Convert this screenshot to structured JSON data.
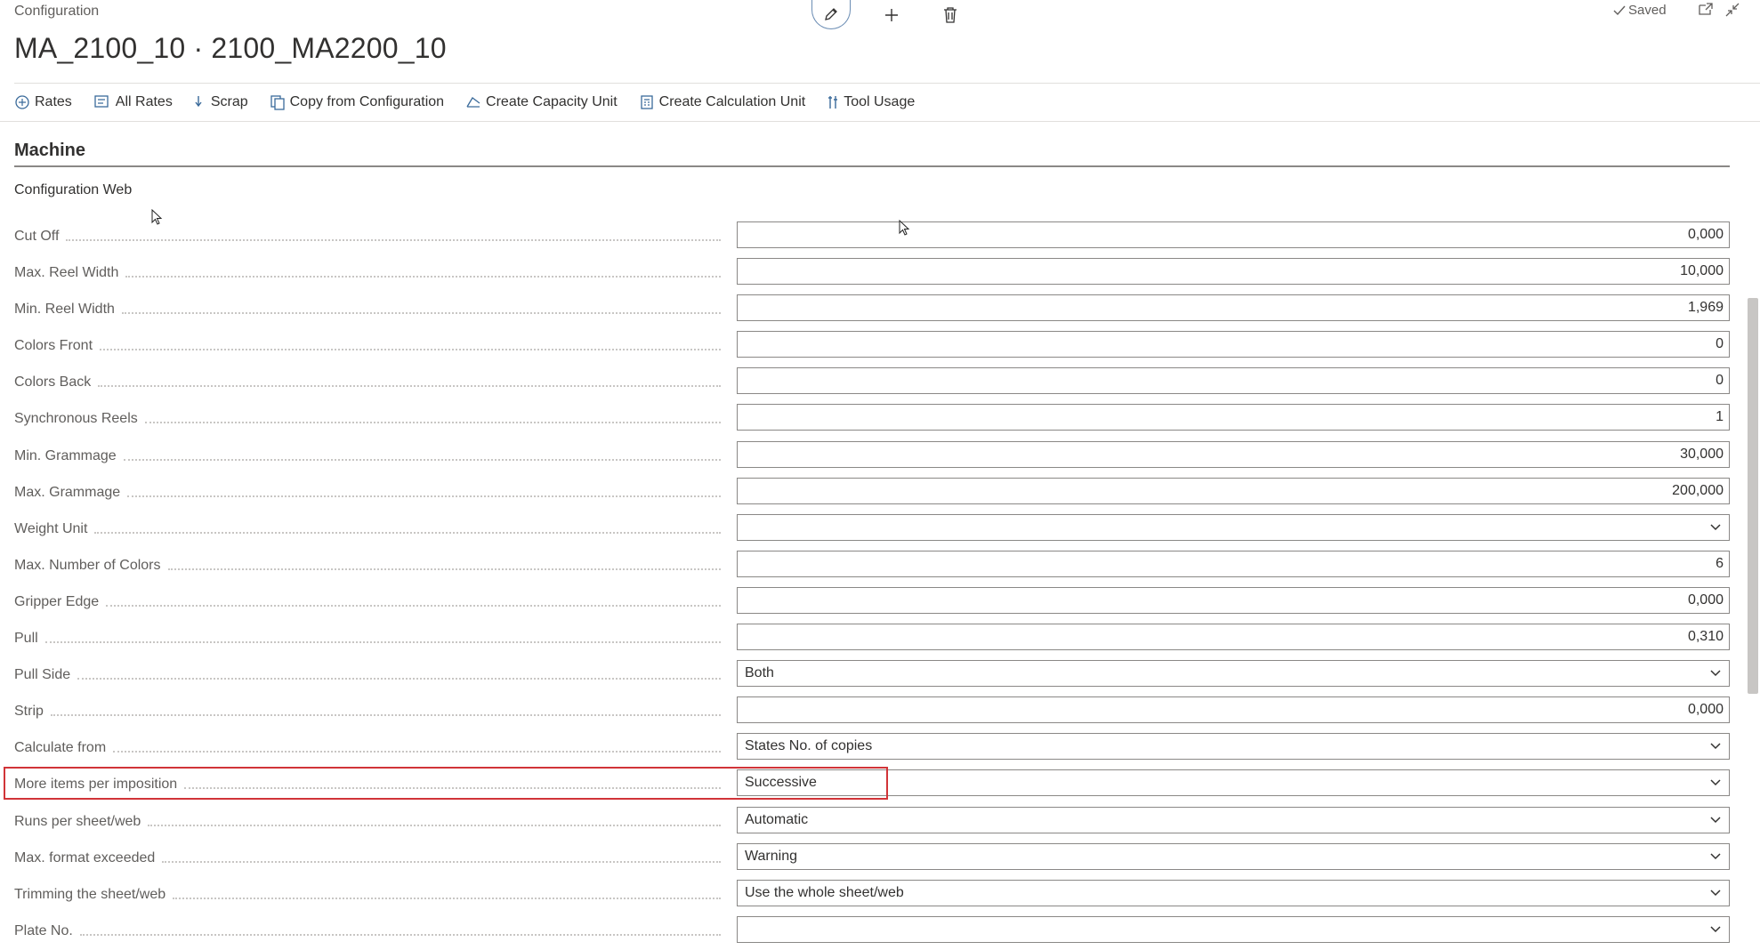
{
  "header": {
    "breadcrumb": "Configuration",
    "title": "MA_2100_10 · 2100_MA2200_10",
    "saved_label": "Saved"
  },
  "actions": [
    {
      "label": "Rates",
      "icon": "rates-icon"
    },
    {
      "label": "All Rates",
      "icon": "all-rates-icon"
    },
    {
      "label": "Scrap",
      "icon": "scrap-icon"
    },
    {
      "label": "Copy from Configuration",
      "icon": "copy-icon"
    },
    {
      "label": "Create Capacity Unit",
      "icon": "capacity-unit-icon"
    },
    {
      "label": "Create Calculation Unit",
      "icon": "calculation-unit-icon"
    },
    {
      "label": "Tool Usage",
      "icon": "tool-icon"
    }
  ],
  "section": {
    "title": "Machine",
    "group_title": "Configuration Web"
  },
  "fields": [
    {
      "label": "Cut Off",
      "value": "0,000",
      "type": "number"
    },
    {
      "label": "Max. Reel Width",
      "value": "10,000",
      "type": "number"
    },
    {
      "label": "Min. Reel Width",
      "value": "1,969",
      "type": "number"
    },
    {
      "label": "Colors Front",
      "value": "0",
      "type": "number"
    },
    {
      "label": "Colors Back",
      "value": "0",
      "type": "number"
    },
    {
      "label": "Synchronous Reels",
      "value": "1",
      "type": "number"
    },
    {
      "label": "Min. Grammage",
      "value": "30,000",
      "type": "number"
    },
    {
      "label": "Max. Grammage",
      "value": "200,000",
      "type": "number"
    },
    {
      "label": "Weight Unit",
      "value": "",
      "type": "select"
    },
    {
      "label": "Max. Number of Colors",
      "value": "6",
      "type": "number"
    },
    {
      "label": "Gripper Edge",
      "value": "0,000",
      "type": "number"
    },
    {
      "label": "Pull",
      "value": "0,310",
      "type": "number"
    },
    {
      "label": "Pull Side",
      "value": "Both",
      "type": "select"
    },
    {
      "label": "Strip",
      "value": "0,000",
      "type": "number"
    },
    {
      "label": "Calculate from",
      "value": "States No. of copies",
      "type": "select"
    },
    {
      "label": "More items per imposition",
      "value": "Successive",
      "type": "select",
      "highlighted": true
    },
    {
      "label": "Runs per sheet/web",
      "value": "Automatic",
      "type": "select"
    },
    {
      "label": "Max. format exceeded",
      "value": "Warning",
      "type": "select"
    },
    {
      "label": "Trimming the sheet/web",
      "value": "Use the whole sheet/web",
      "type": "select"
    },
    {
      "label": "Plate No.",
      "value": "",
      "type": "select"
    }
  ],
  "colors": {
    "highlight_border": "#d13438",
    "field_border": "#8a8886",
    "label_text": "#605e5c"
  }
}
